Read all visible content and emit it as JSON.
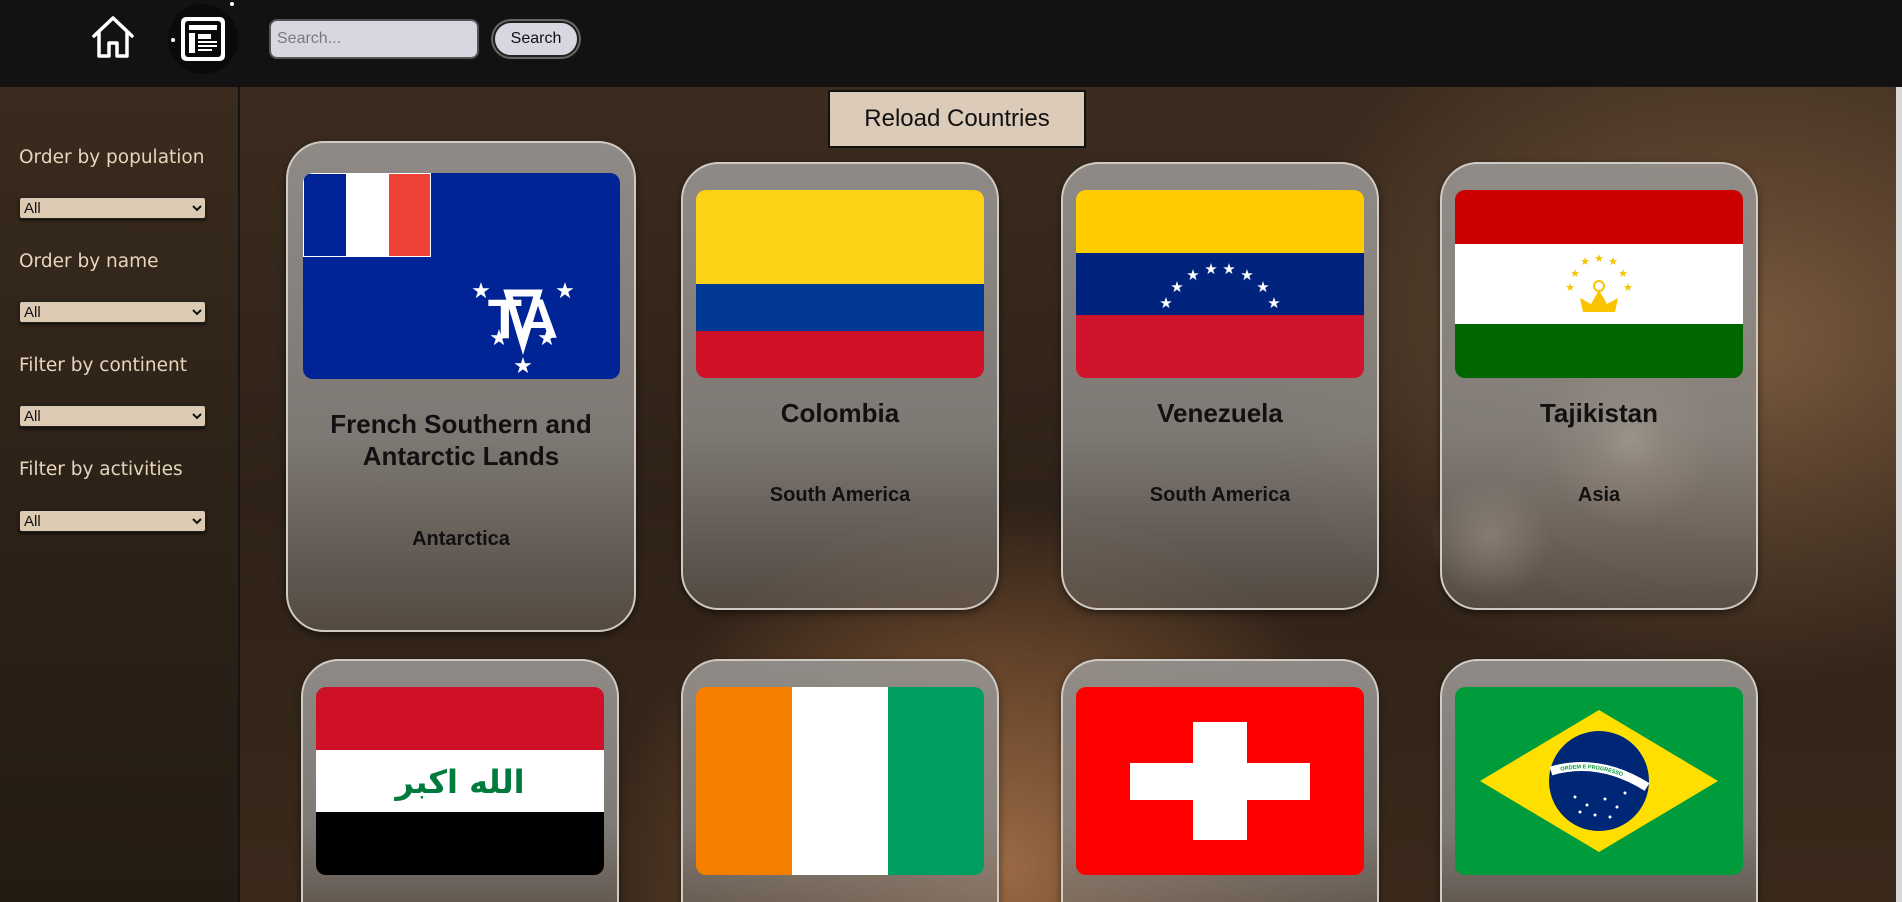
{
  "nav": {
    "home_icon": "home-icon",
    "logo_icon": "activity-form-icon",
    "search_placeholder": "Search...",
    "search_label": "Search"
  },
  "sidebar": {
    "filters": [
      {
        "label": "Order by population",
        "value": "All"
      },
      {
        "label": "Order by name",
        "value": "All"
      },
      {
        "label": "Filter by continent",
        "value": "All"
      },
      {
        "label": "Filter by activities",
        "value": "All"
      }
    ]
  },
  "main": {
    "reload_label": "Reload Countries",
    "cards": [
      {
        "name": "French Southern and Antarctic Lands",
        "continent": "Antarctica",
        "flag": "french-southern-antarctic-lands-flag"
      },
      {
        "name": "Colombia",
        "continent": "South America",
        "flag": "colombia-flag"
      },
      {
        "name": "Venezuela",
        "continent": "South America",
        "flag": "venezuela-flag"
      },
      {
        "name": "Tajikistan",
        "continent": "Asia",
        "flag": "tajikistan-flag"
      },
      {
        "name": "",
        "continent": "",
        "flag": "iraq-flag",
        "flag_text": "الله اكبر"
      },
      {
        "name": "",
        "continent": "",
        "flag": "ivory-coast-flag"
      },
      {
        "name": "",
        "continent": "",
        "flag": "switzerland-flag"
      },
      {
        "name": "",
        "continent": "",
        "flag": "brazil-flag",
        "flag_text": "ORDEM E PROGRESSO"
      }
    ]
  },
  "colors": {
    "topbar": "#141112",
    "sidebar": "#2e2318",
    "sidebar_text": "#e6d6bd",
    "select_bg": "#dccbb2",
    "reload_bg": "#dccbb8"
  }
}
